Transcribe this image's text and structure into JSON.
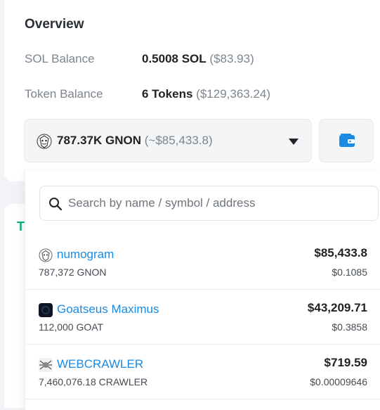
{
  "overview": {
    "title": "Overview",
    "sol_label": "SOL Balance",
    "sol_value": "0.5008 SOL",
    "sol_usd": "($83.93)",
    "token_label": "Token Balance",
    "token_value": "6 Tokens",
    "token_usd": "($129,363.24)"
  },
  "selector": {
    "selected_amount": "787.37K GNON",
    "selected_usd": "(~$85,433.8)",
    "icon": "chevron-down-icon"
  },
  "wallet_button": {
    "icon": "wallet-icon",
    "color": "#1a8be4"
  },
  "lower_card": {
    "heading_fragment": "T"
  },
  "search": {
    "placeholder": "Search by name / symbol / address",
    "value": ""
  },
  "tokens": [
    {
      "name": "numogram",
      "amount": "787,372 GNON",
      "usd": "$85,433.8",
      "price": "$0.1085",
      "icon": "numogram-logo"
    },
    {
      "name": "Goatseus Maximus",
      "amount": "112,000 GOAT",
      "usd": "$43,209.71",
      "price": "$0.3858",
      "icon": "goatseus-logo"
    },
    {
      "name": "WEBCRAWLER",
      "amount": "7,460,076.18 CRAWLER",
      "usd": "$719.59",
      "price": "$0.00009646",
      "icon": "webcrawler-logo"
    }
  ],
  "colors": {
    "link": "#1a8be4",
    "accent_green": "#11b27a"
  }
}
